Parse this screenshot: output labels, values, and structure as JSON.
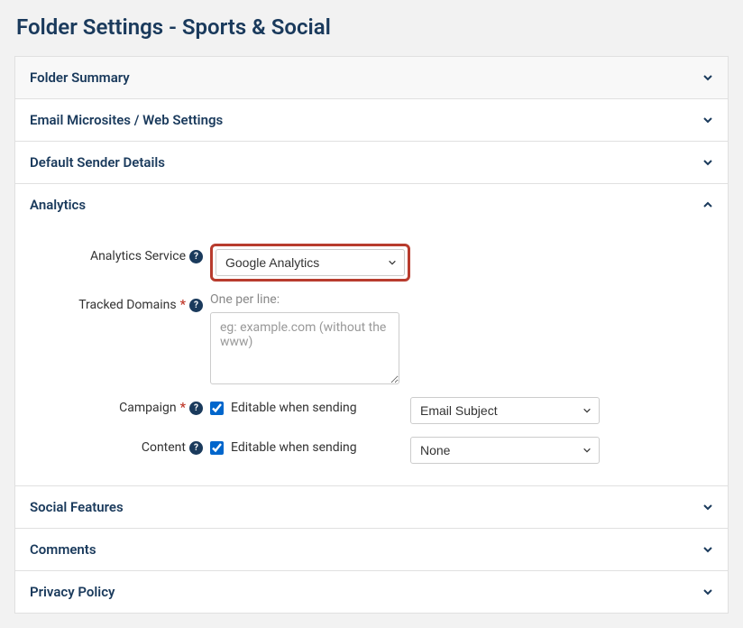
{
  "page": {
    "title": "Folder Settings - Sports & Social"
  },
  "sections": {
    "folder_summary": {
      "title": "Folder Summary",
      "expanded": false
    },
    "email_microsites": {
      "title": "Email Microsites / Web Settings",
      "expanded": false
    },
    "default_sender": {
      "title": "Default Sender Details",
      "expanded": false
    },
    "analytics": {
      "title": "Analytics",
      "expanded": true
    },
    "social_features": {
      "title": "Social Features",
      "expanded": false
    },
    "comments": {
      "title": "Comments",
      "expanded": false
    },
    "privacy_policy": {
      "title": "Privacy Policy",
      "expanded": false
    }
  },
  "analytics": {
    "service_label": "Analytics Service",
    "service_value": "Google Analytics",
    "tracked_domains_label": "Tracked Domains",
    "tracked_domains_hint": "One per line:",
    "tracked_domains_placeholder": "eg: example.com (without the www)",
    "tracked_domains_value": "",
    "campaign_label": "Campaign",
    "campaign_editable_label": "Editable when sending",
    "campaign_editable_checked": true,
    "campaign_select_value": "Email Subject",
    "content_label": "Content",
    "content_editable_label": "Editable when sending",
    "content_editable_checked": true,
    "content_select_value": "None"
  }
}
